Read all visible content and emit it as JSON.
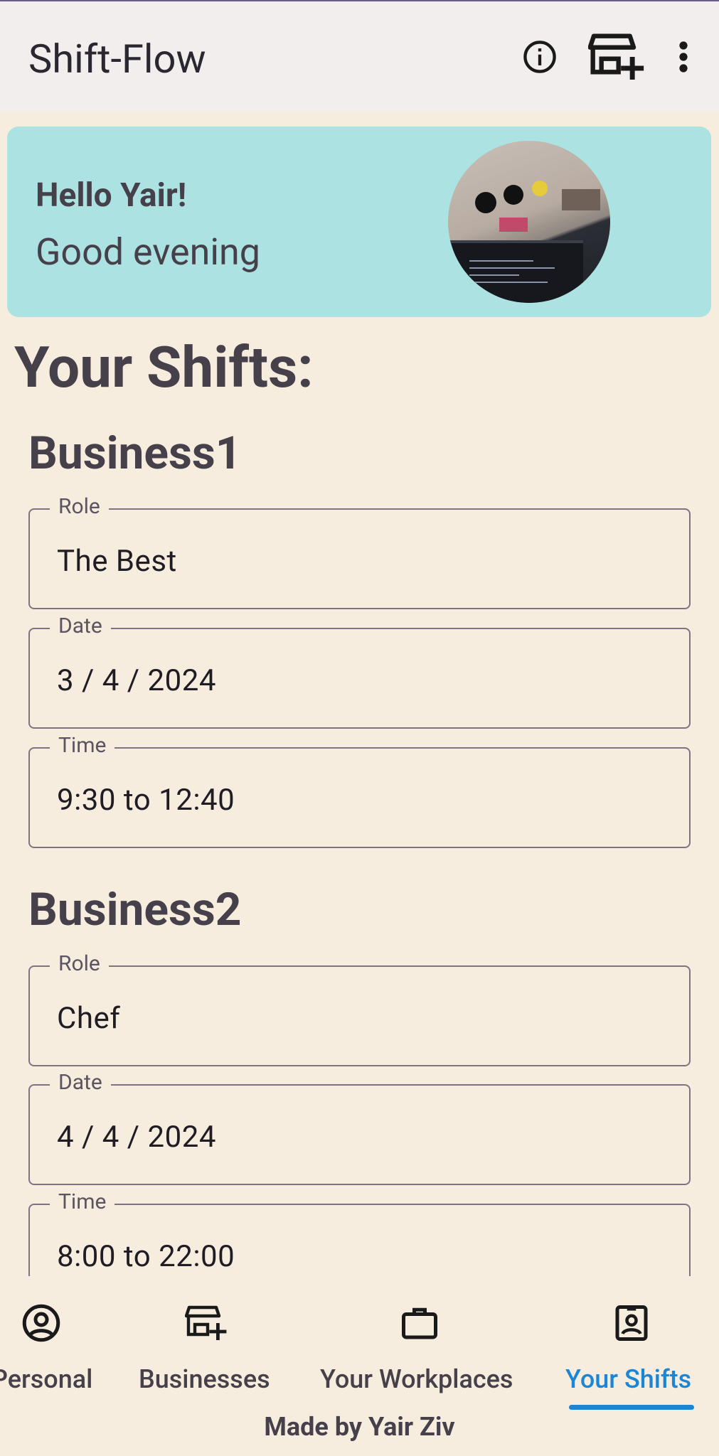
{
  "app": {
    "title": "Shift-Flow"
  },
  "greeting": {
    "hello": "Hello Yair!",
    "sub": "Good evening"
  },
  "section_title": "Your Shifts:",
  "shifts": [
    {
      "business": "Business1",
      "fields": [
        {
          "label": "Role",
          "value": "The Best"
        },
        {
          "label": "Date",
          "value": "3 / 4 / 2024"
        },
        {
          "label": "Time",
          "value": "9:30 to 12:40"
        }
      ]
    },
    {
      "business": "Business2",
      "fields": [
        {
          "label": "Role",
          "value": "Chef"
        },
        {
          "label": "Date",
          "value": "4 / 4 / 2024"
        },
        {
          "label": "Time",
          "value": "8:00 to 22:00"
        }
      ]
    }
  ],
  "nav": {
    "items": [
      {
        "label": "Personal",
        "icon": "account-circle-icon"
      },
      {
        "label": "Businesses",
        "icon": "add-business-icon"
      },
      {
        "label": "Your Workplaces",
        "icon": "briefcase-icon"
      },
      {
        "label": "Your Shifts",
        "icon": "badge-icon",
        "active": true
      }
    ],
    "active_color": "#1c86d6"
  },
  "footer": "Made by Yair Ziv",
  "colors": {
    "background": "#f7eddf",
    "card": "#ace2e2",
    "appbar": "#f3eeee",
    "accent": "#1c86d6"
  }
}
